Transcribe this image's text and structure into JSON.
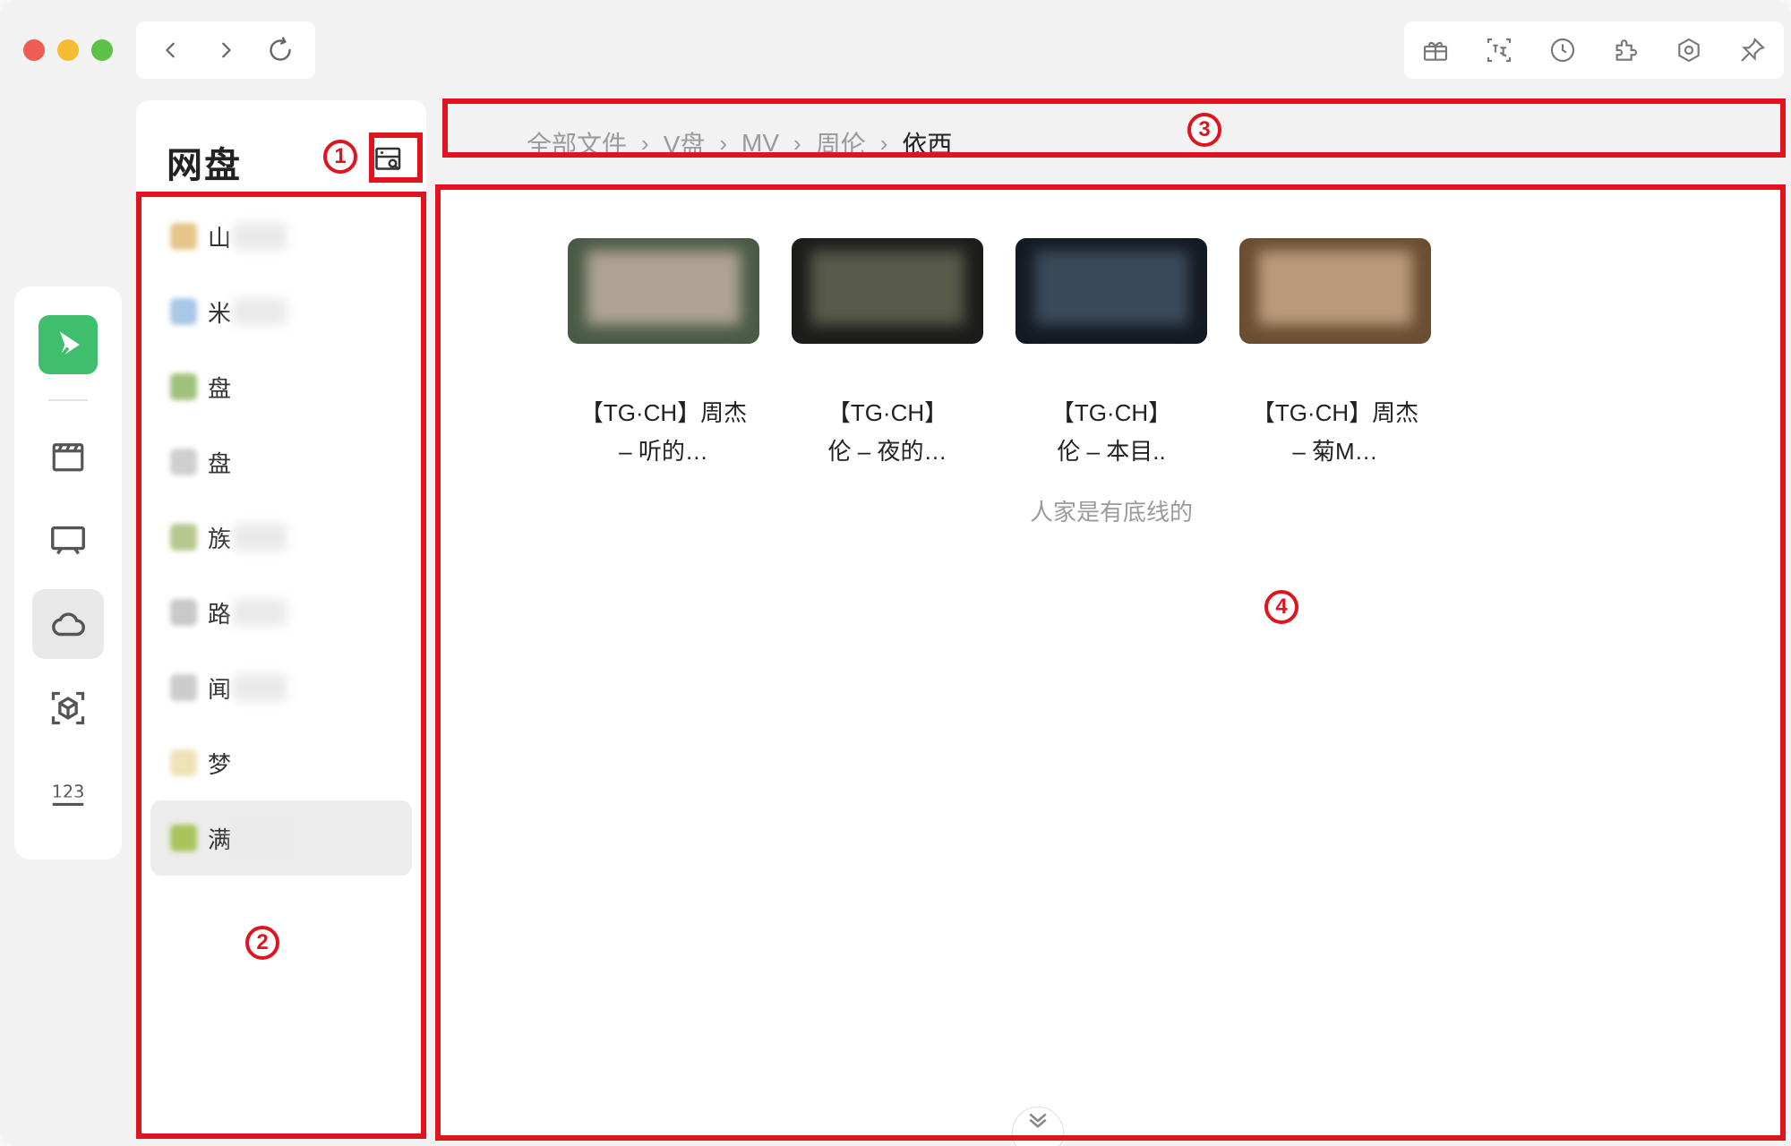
{
  "sidebar": {
    "title": "网盘",
    "drives": [
      {
        "label": "山",
        "color": "#e6c58a"
      },
      {
        "label": "米",
        "color": "#a9c7e6"
      },
      {
        "label": "盘",
        "color": "#9fc17b"
      },
      {
        "label": "盘",
        "color": "#cfcfcf"
      },
      {
        "label": "族",
        "color": "#b7c78e"
      },
      {
        "label": "路",
        "color": "#c9c9c9"
      },
      {
        "label": "闻",
        "color": "#cccccc"
      },
      {
        "label": "梦",
        "color": "#f0e2b8"
      },
      {
        "label": "满",
        "color": "#a8c45a"
      }
    ]
  },
  "breadcrumb": {
    "items": [
      "全部文件",
      "V盘",
      "MV",
      "周伦",
      "依西"
    ]
  },
  "main": {
    "files": [
      {
        "line1": "【TG·CH】周杰",
        "line2": "– 听的…"
      },
      {
        "line1": "【TG·CH】",
        "line2": "伦 – 夜的…"
      },
      {
        "line1": "【TG·CH】",
        "line2": "伦 – 本目.."
      },
      {
        "line1": "【TG·CH】周杰",
        "line2": "– 菊M…"
      }
    ],
    "empty_note": "人家是有底线的"
  },
  "rail": {
    "items": [
      "logo-icon",
      "film-icon",
      "tv-icon",
      "cloud-icon",
      "cube-scan-icon",
      "number-123-icon"
    ],
    "active": "cloud-icon"
  },
  "toolbar": {
    "icons": [
      "gift-icon",
      "translate-icon",
      "history-icon",
      "extension-icon",
      "settings-icon",
      "pin-icon"
    ]
  },
  "annotations": [
    "1",
    "2",
    "3",
    "4"
  ]
}
